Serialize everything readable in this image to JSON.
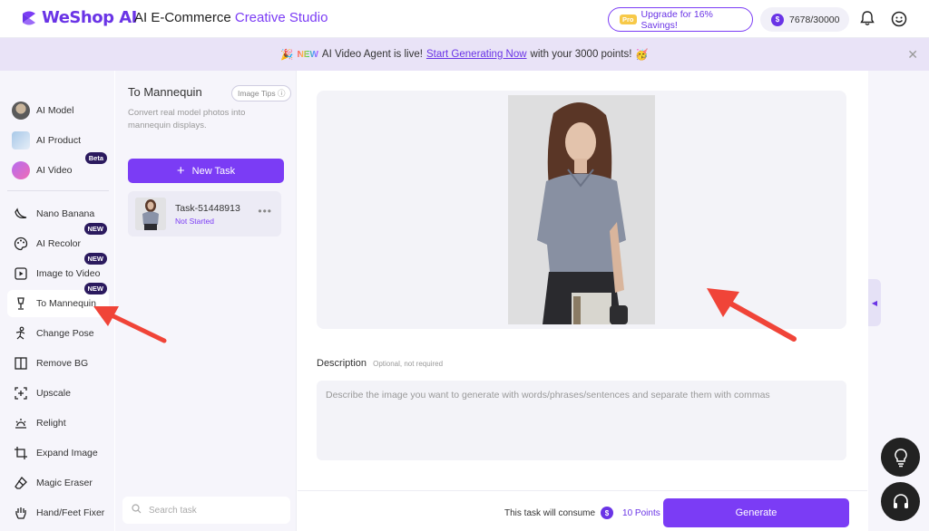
{
  "header": {
    "logo_text": "WeShop AI",
    "studio_title_main": "AI E-Commerce",
    "studio_title_accent": "Creative Studio",
    "upgrade_tag": "Pro",
    "upgrade_label": "Upgrade for 16% Savings!",
    "points_coin": "$",
    "points_value": "7678/30000",
    "icons": [
      "bell-icon",
      "smile-icon"
    ]
  },
  "banner": {
    "new_tag": "NEW",
    "text_before": "AI Video Agent is live!",
    "link_text": "Start Generating Now",
    "text_after": "with your 3000 points!"
  },
  "sidebar": {
    "items": [
      {
        "label": "AI Model",
        "icon": "ai-model-avatar"
      },
      {
        "label": "AI Product",
        "icon": "ai-product-avatar"
      },
      {
        "label": "AI Video",
        "icon": "ai-video-icon",
        "badge": "Beta"
      },
      {
        "label": "Nano Banana",
        "icon": "banana-icon"
      },
      {
        "label": "AI Recolor",
        "icon": "palette-icon",
        "badge": "NEW"
      },
      {
        "label": "Image to Video",
        "icon": "video-icon",
        "badge": "NEW"
      },
      {
        "label": "To Mannequin",
        "icon": "mannequin-icon",
        "badge": "NEW",
        "active": true
      },
      {
        "label": "Change Pose",
        "icon": "pose-icon"
      },
      {
        "label": "Remove BG",
        "icon": "remove-bg-icon"
      },
      {
        "label": "Upscale",
        "icon": "upscale-icon"
      },
      {
        "label": "Relight",
        "icon": "relight-icon"
      },
      {
        "label": "Expand Image",
        "icon": "expand-icon"
      },
      {
        "label": "Magic Eraser",
        "icon": "eraser-icon"
      },
      {
        "label": "Hand/Feet Fixer",
        "icon": "hand-icon"
      }
    ]
  },
  "task_panel": {
    "title": "To Mannequin",
    "image_tips": "Image Tips",
    "description": "Convert real model photos into mannequin displays.",
    "new_task_label": "New Task",
    "task": {
      "name": "Task-51448913",
      "status": "Not Started"
    },
    "search_placeholder": "Search task"
  },
  "main": {
    "description_label": "Description",
    "description_hint": "Optional, not required",
    "description_placeholder": "Describe the image you want to generate with words/phrases/sentences and separate them with commas",
    "consume_text": "This task will consume",
    "consume_points": "10 Points",
    "generate_label": "Generate"
  },
  "colors": {
    "accent": "#7b3cf5",
    "badge_dark": "#2b1a5e",
    "banner_bg": "#e9e3f7",
    "annotation_arrow": "#f04438"
  }
}
